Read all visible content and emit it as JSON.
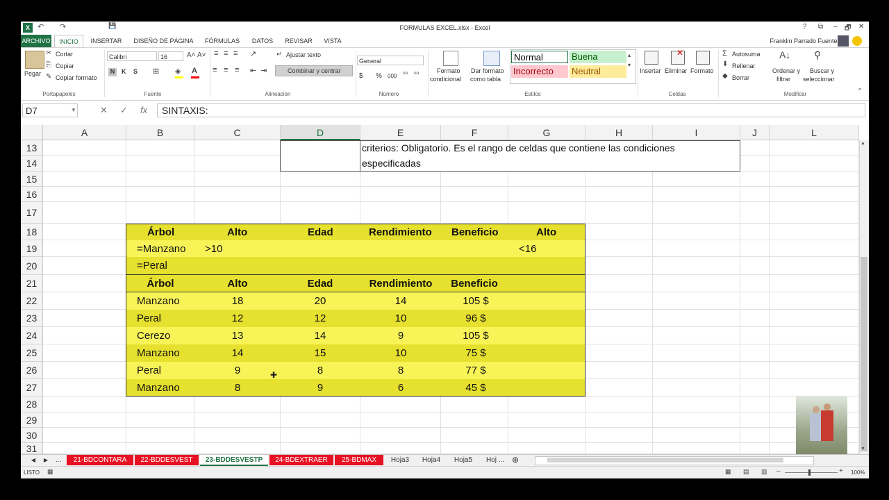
{
  "window": {
    "title": "FORMULAS EXCEL.xlsx - Excel",
    "user": "Franklin Parrado Fuentes",
    "controls": [
      "?",
      "⧉",
      "–",
      "🗗",
      "✕"
    ]
  },
  "quick_access": [
    "↶",
    "↷",
    "💾"
  ],
  "tabs": [
    "ARCHIVO",
    "INICIO",
    "INSERTAR",
    "DISEÑO DE PÁGINA",
    "FÓRMULAS",
    "DATOS",
    "REVISAR",
    "VISTA"
  ],
  "ribbon": {
    "clipboard": {
      "paste": "Pegar",
      "cut": "Cortar",
      "copy": "Copiar",
      "format_painter": "Copiar formato",
      "group": "Portapapeles"
    },
    "font": {
      "name": "Calibri",
      "size": "16",
      "bold": "N",
      "italic": "K",
      "underline": "S",
      "group": "Fuente"
    },
    "alignment": {
      "wrap": "Ajustar texto",
      "merge": "Combinar y centrar",
      "group": "Alineación"
    },
    "number": {
      "format": "General",
      "group": "Número",
      "currency": "$",
      "percent": "%",
      "thousands": "000"
    },
    "styles": {
      "cond_format_1": "Formato",
      "cond_format_2": "condicional",
      "table_format_1": "Dar formato",
      "table_format_2": "como tabla",
      "normal": "Normal",
      "good": "Buena",
      "bad": "Incorrecto",
      "neutral": "Neutral",
      "group": "Estilos"
    },
    "cells": {
      "insert": "Insertar",
      "delete": "Eliminar",
      "format": "Formato",
      "group": "Celdas"
    },
    "editing": {
      "autosum": "Autosuma",
      "fill": "Rellenar",
      "clear": "Borrar",
      "sort_1": "Ordenar y",
      "sort_2": "filtrar",
      "find_1": "Buscar y",
      "find_2": "seleccionar",
      "group": "Modificar"
    }
  },
  "formula_bar": {
    "name_box": "D7",
    "formula": "SINTAXIS:",
    "fx": "fx"
  },
  "columns": [
    "A",
    "B",
    "C",
    "D",
    "E",
    "F",
    "G",
    "H",
    "I",
    "J",
    "L"
  ],
  "rows": [
    "13",
    "14",
    "15",
    "16",
    "17",
    "18",
    "19",
    "20",
    "21",
    "22",
    "23",
    "24",
    "25",
    "26",
    "27",
    "28",
    "29",
    "30",
    "31"
  ],
  "note": {
    "line1": "criterios: Obligatorio. Es el rango de celdas que contiene las condiciones",
    "line2": "especificadas"
  },
  "criteria": {
    "headers": [
      "Árbol",
      "Alto",
      "Edad",
      "Rendimiento",
      "Beneficio",
      "Alto"
    ],
    "row18": [
      "=Manzano",
      ">10",
      "",
      "",
      "",
      "<16"
    ],
    "row19": [
      "=Peral",
      "",
      "",
      "",
      "",
      ""
    ]
  },
  "table": {
    "headers": [
      "Árbol",
      "Alto",
      "Edad",
      "Rendimiento",
      "Beneficio"
    ],
    "rows": [
      [
        "Manzano",
        "18",
        "20",
        "14",
        "105 $"
      ],
      [
        "Peral",
        "12",
        "12",
        "10",
        "96 $"
      ],
      [
        "Cerezo",
        "13",
        "14",
        "9",
        "105 $"
      ],
      [
        "Manzano",
        "14",
        "15",
        "10",
        "75 $"
      ],
      [
        "Peral",
        "9",
        "8",
        "8",
        "77 $"
      ],
      [
        "Manzano",
        "8",
        "9",
        "6",
        "45 $"
      ]
    ]
  },
  "sheet_tabs": [
    "...",
    "21-BDCONTARA",
    "22-BDDESVEST",
    "23-BDDESVESTP",
    "24-BDEXTRAER",
    "25-BDMAX",
    "Hoja3",
    "Hoja4",
    "Hoja5",
    "Hoj ..."
  ],
  "status": {
    "mode": "LISTO",
    "zoom": "100%"
  },
  "colors": {
    "excel_green": "#217346",
    "yellow_dark": "#e6e02e",
    "yellow_light": "#f8f458",
    "tab_red": "#e81123"
  }
}
